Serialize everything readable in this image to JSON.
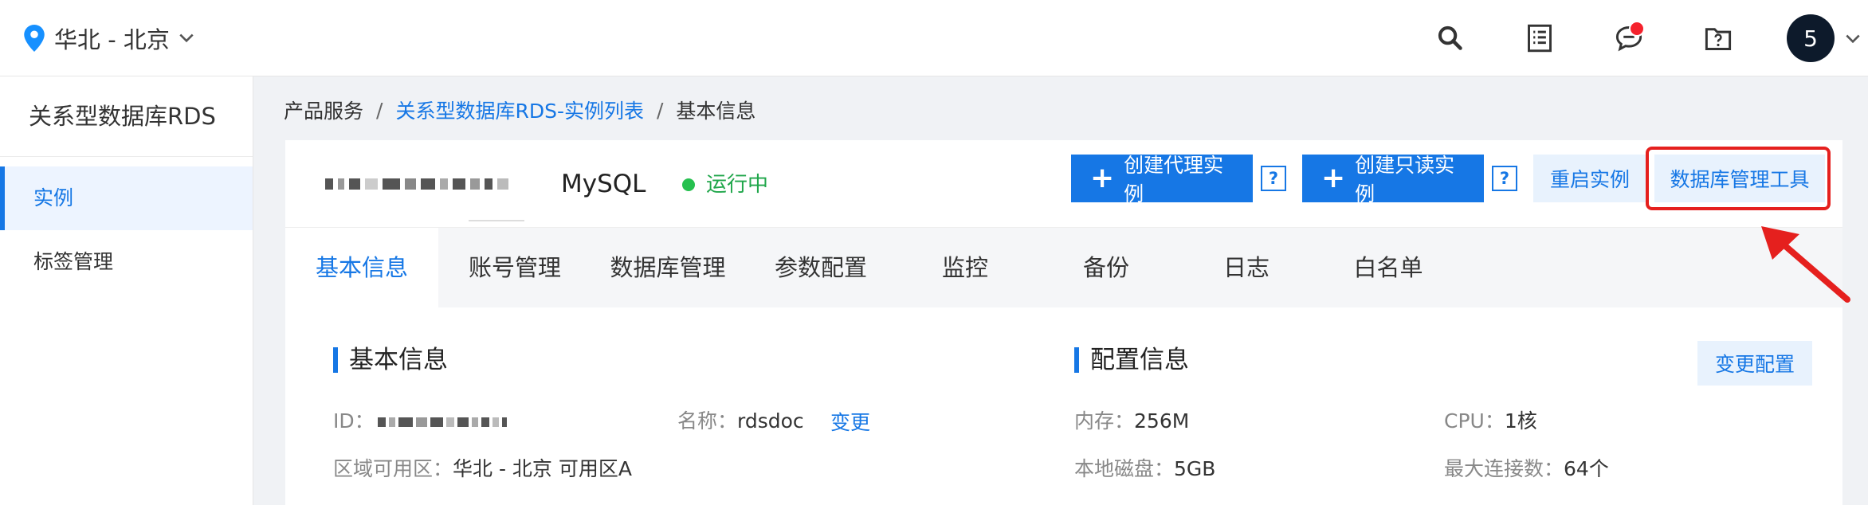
{
  "topbar": {
    "region_label": "华北 - 北京",
    "icons": [
      "search-icon",
      "document-list-icon",
      "message-icon",
      "folder-help-icon"
    ],
    "avatar_text": "5"
  },
  "sidebar": {
    "title": "关系型数据库RDS",
    "items": [
      {
        "label": "实例",
        "active": true
      },
      {
        "label": "标签管理",
        "active": false
      }
    ]
  },
  "breadcrumb": {
    "root": "产品服务",
    "sep": "/",
    "list": "关系型数据库RDS-实例列表",
    "current": "基本信息"
  },
  "instance": {
    "engine": "MySQL",
    "status": "运行中",
    "status_color": "#1fa64a"
  },
  "actions": {
    "plus": "+",
    "create_proxy": "创建代理实例",
    "create_readonly": "创建只读实例",
    "help": "?",
    "restart": "重启实例",
    "db_tool": "数据库管理工具"
  },
  "tabs": [
    "基本信息",
    "账号管理",
    "数据库管理",
    "参数配置",
    "监控",
    "备份",
    "日志",
    "白名单"
  ],
  "basic_info": {
    "title": "基本信息",
    "id_label": "ID：",
    "name_label": "名称：",
    "name_value": "rdsdoc",
    "name_change": "变更",
    "zone_label": "区域可用区：",
    "zone_value": "华北 - 北京 可用区A"
  },
  "config_info": {
    "title": "配置信息",
    "change_button": "变更配置",
    "memory_label": "内存：",
    "memory_value": "256M",
    "cpu_label": "CPU：",
    "cpu_value": "1核",
    "disk_label": "本地磁盘：",
    "disk_value": "5GB",
    "maxconn_label": "最大连接数：",
    "maxconn_value": "64个"
  },
  "colors": {
    "accent": "#1677e5",
    "highlight": "#e5201e"
  }
}
